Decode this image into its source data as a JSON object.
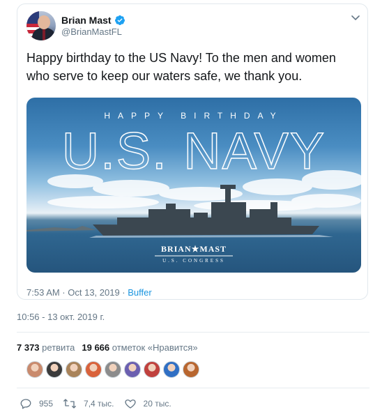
{
  "tweet": {
    "display_name": "Brian Mast",
    "handle": "@BrianMastFL",
    "text": "Happy birthday to the US Navy! To the men and women who serve to keep our waters safe, we thank you.",
    "image": {
      "headline_small": "HAPPY BIRTHDAY",
      "headline_large": "U.S. NAVY",
      "logo_name": "BRIAN★MAST",
      "logo_sub": "U.S. CONGRESS"
    },
    "time": "7:53 AM · Oct 13, 2019 · ",
    "source": "Buffer"
  },
  "timestamp": "10:56 - 13 окт. 2019 г.",
  "stats": {
    "retweets_count": "7 373",
    "retweets_label": "ретвита",
    "likes_count": "19 666",
    "likes_label": "отметок «Нравится»"
  },
  "likers": [
    {
      "color": "#c98a6d"
    },
    {
      "color": "#3b3b3b"
    },
    {
      "color": "#a9835a"
    },
    {
      "color": "#d9623b"
    },
    {
      "color": "#8c8c8c"
    },
    {
      "color": "#6b5fb0"
    },
    {
      "color": "#c0413d"
    },
    {
      "color": "#2f6fc4"
    },
    {
      "color": "#b8662f"
    }
  ],
  "actions": {
    "replies": "955",
    "retweets": "7,4 тыс.",
    "likes": "20 тыс."
  },
  "colors": {
    "accent": "#1b95e0",
    "text": "#14171a",
    "muted": "#657786"
  }
}
